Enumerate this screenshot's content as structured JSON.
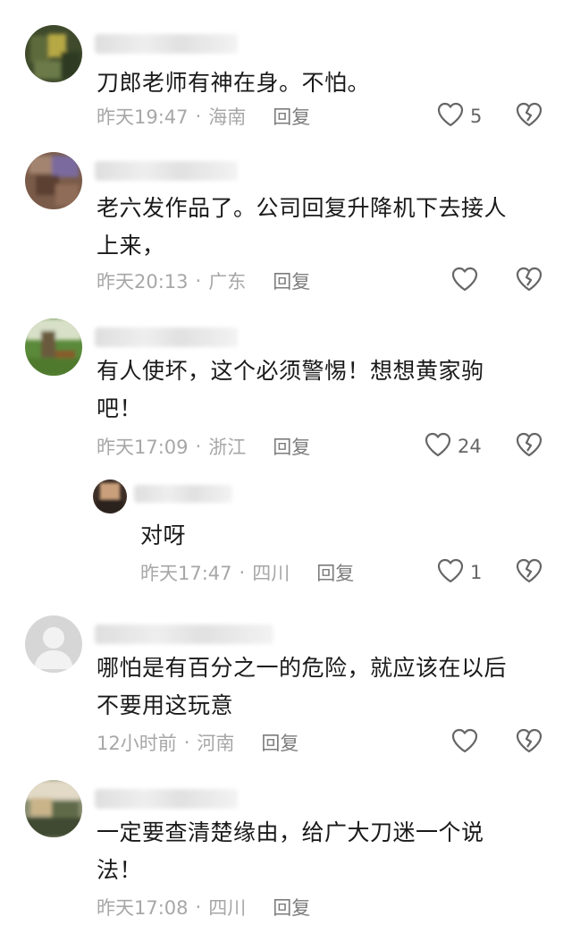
{
  "comments": [
    {
      "text": "刀郎老师有神在身。不怕。",
      "time": "昨天19:47",
      "location": "海南",
      "reply_label": "回复",
      "likes": "5"
    },
    {
      "text": "老六发作品了。公司回复升降机下去接人\n上来，",
      "time": "昨天20:13",
      "location": "广东",
      "reply_label": "回复",
      "likes": ""
    },
    {
      "text": "有人使坏，这个必须警惕！想想黄家驹\n吧！",
      "time": "昨天17:09",
      "location": "浙江",
      "reply_label": "回复",
      "likes": "24"
    },
    {
      "text": "对呀",
      "time": "昨天17:47",
      "location": "四川",
      "reply_label": "回复",
      "likes": "1"
    },
    {
      "text": "哪怕是有百分之一的危险，就应该在以后\n不要用这玩意",
      "time": "12小时前",
      "location": "河南",
      "reply_label": "回复",
      "likes": ""
    },
    {
      "text": "一定要查清楚缘由，给广大刀迷一个说\n法！",
      "time": "昨天17:08",
      "location": "四川",
      "reply_label": "回复",
      "likes": ""
    }
  ],
  "separator": "·",
  "icons": {
    "like": "heart-outline-icon",
    "dislike": "broken-heart-icon"
  },
  "colors": {
    "text": "#1a1a1a",
    "meta": "#a7a7a7",
    "reply": "#7c7c7c",
    "icon": "#666666"
  }
}
